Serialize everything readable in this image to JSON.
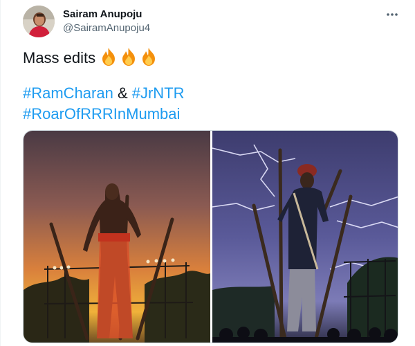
{
  "tweet": {
    "author_name": "Sairam Anupoju",
    "author_handle": "@SairamAnupoju4",
    "text_line1": "Mass edits ",
    "emojis": [
      "fire-emoji",
      "fire-emoji",
      "fire-emoji"
    ],
    "hashtag1": "#RamCharan",
    "ampersand": " & ",
    "hashtag2": "#JrNTR",
    "hashtag3": "#RoarOfRRRInMumbai",
    "more_icon": "more-horizontal-icon"
  },
  "media": {
    "photos": [
      {
        "name": "photo-left",
        "description_icon": "warrior-stage-sunset-photo"
      },
      {
        "name": "photo-right",
        "description_icon": "warrior-stage-lightning-photo"
      }
    ]
  },
  "colors": {
    "link": "#1d9bf0",
    "text": "#0f1419",
    "secondary": "#536471",
    "border": "#cfd9de"
  }
}
